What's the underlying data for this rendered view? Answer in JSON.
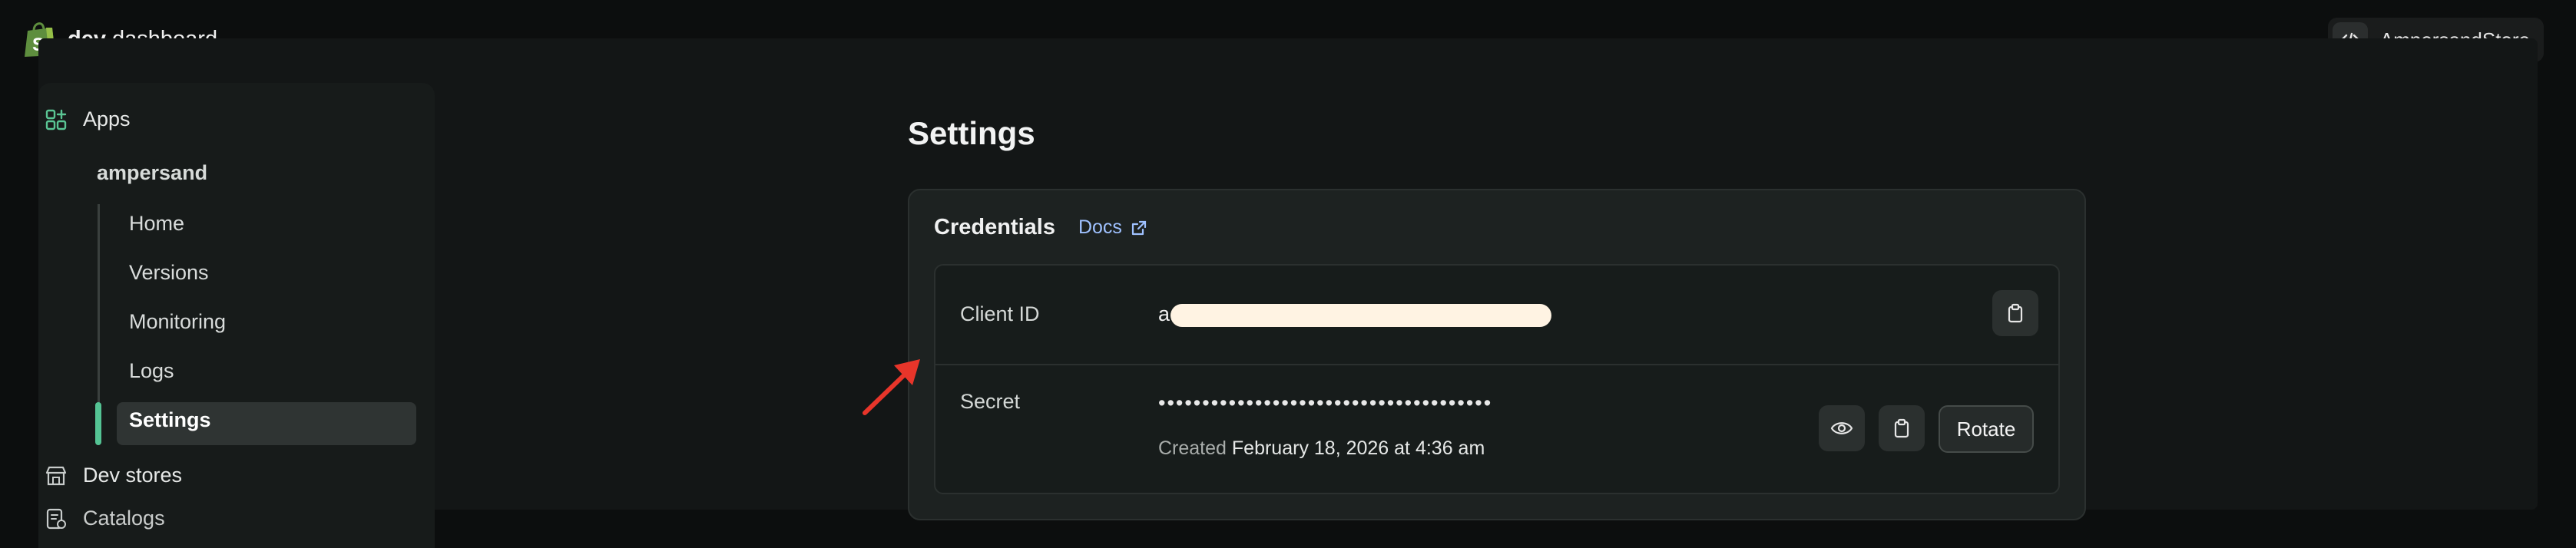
{
  "app": {
    "title_bold": "dev",
    "title_rest": " dashboard"
  },
  "store": {
    "name": "AmpersandStore"
  },
  "sidebar": {
    "apps_label": "Apps",
    "app_name": "ampersand",
    "items": [
      {
        "label": "Home"
      },
      {
        "label": "Versions"
      },
      {
        "label": "Monitoring"
      },
      {
        "label": "Logs"
      },
      {
        "label": "Settings",
        "active": true
      }
    ],
    "dev_stores_label": "Dev stores",
    "catalogs_label": "Catalogs"
  },
  "page": {
    "title": "Settings"
  },
  "credentials": {
    "title": "Credentials",
    "docs_label": "Docs",
    "client_id_label": "Client ID",
    "client_id_prefix": "a",
    "secret_label": "Secret",
    "secret_masked": "••••••••••••••••••••••••••••••••••••••",
    "created_prefix": "Created",
    "created_date": "February 18, 2026 at 4:36 am",
    "rotate_label": "Rotate"
  },
  "colors": {
    "accent": "#54c494",
    "link": "#9fc1ff",
    "annotation_arrow": "#e8352a"
  }
}
